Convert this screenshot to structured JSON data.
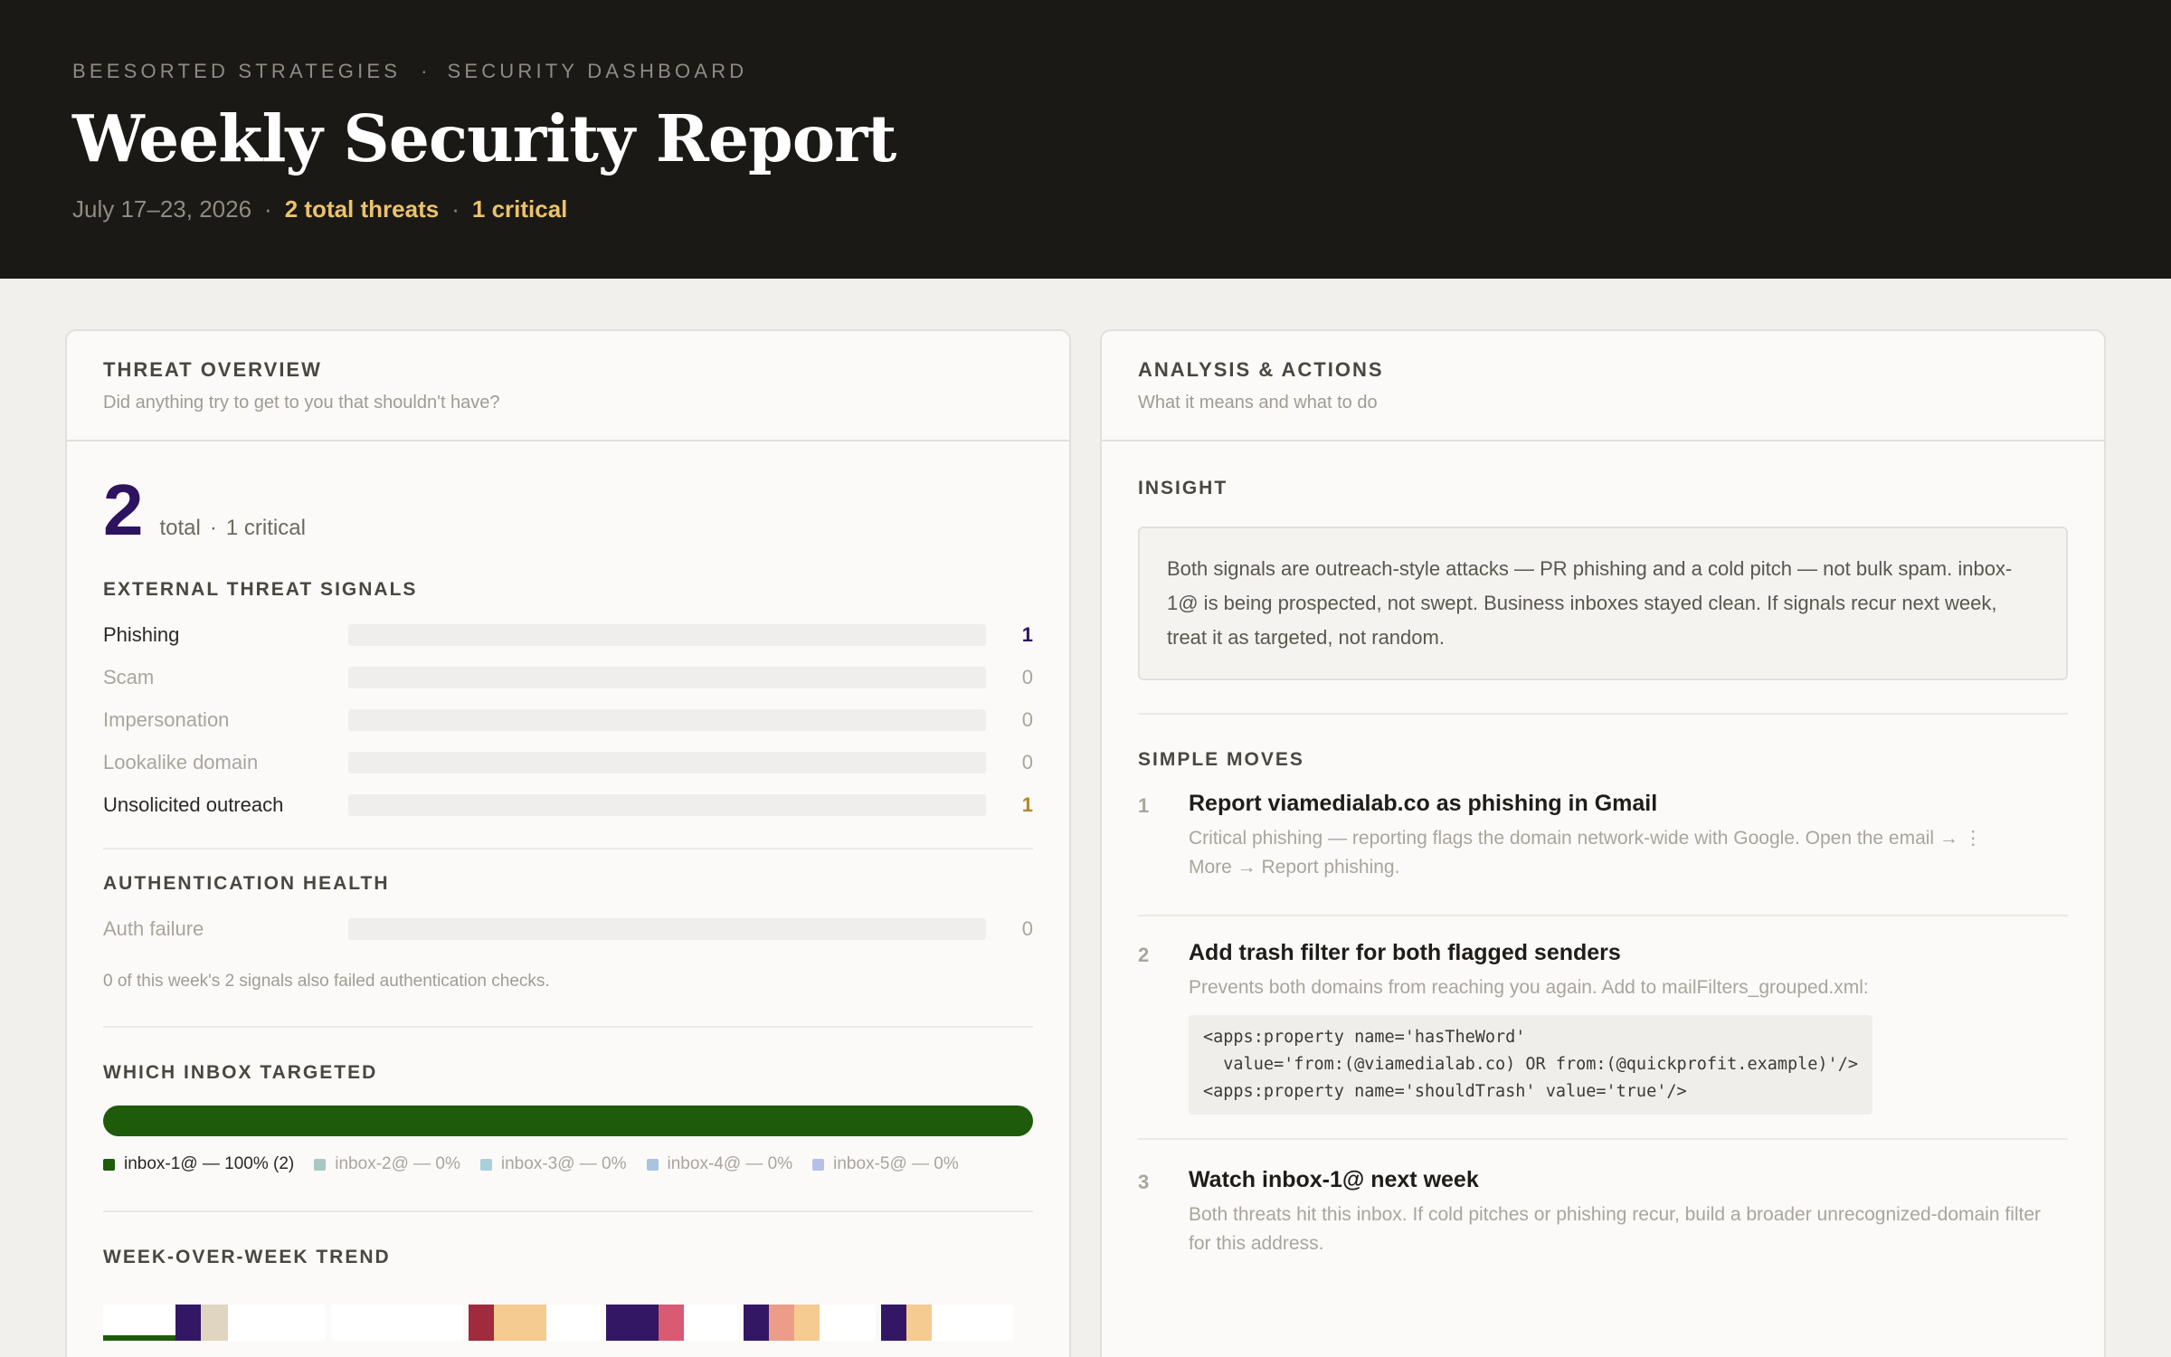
{
  "header": {
    "org": "BEESORTED STRATEGIES",
    "sep": "·",
    "section": "SECURITY DASHBOARD",
    "title": "Weekly Security Report",
    "date_range": "July 17–23, 2026",
    "total_threats": "2 total threats",
    "critical": "1 critical"
  },
  "threat_overview": {
    "title": "THREAT OVERVIEW",
    "subtitle": "Did anything try to get to you that shouldn't have?",
    "total": "2",
    "total_label": "total",
    "critical_label": "1 critical",
    "external_title": "EXTERNAL THREAT SIGNALS",
    "signals": [
      {
        "label": "Phishing",
        "value": "1",
        "fraction": 0.5,
        "color": "#331764"
      },
      {
        "label": "Scam",
        "value": "0",
        "fraction": 0,
        "color": "#cccccc"
      },
      {
        "label": "Impersonation",
        "value": "0",
        "fraction": 0,
        "color": "#cccccc"
      },
      {
        "label": "Lookalike domain",
        "value": "0",
        "fraction": 0,
        "color": "#cccccc"
      },
      {
        "label": "Unsolicited outreach",
        "value": "1",
        "fraction": 0.5,
        "color": "#f5cb91"
      }
    ],
    "auth_title": "AUTHENTICATION HEALTH",
    "auth": {
      "label": "Auth failure",
      "value": "0",
      "fraction": 0
    },
    "auth_note": "0 of this week's 2 signals also failed authentication checks.",
    "inbox_title": "WHICH INBOX TARGETED",
    "inbox_bar_color": "#1e5c0b",
    "inboxes": [
      {
        "label": "inbox-1@ — 100% (2)",
        "color": "#1e5c0b",
        "share": 1.0
      },
      {
        "label": "inbox-2@ — 0%",
        "color": "#a8c8c3",
        "share": 0
      },
      {
        "label": "inbox-3@ — 0%",
        "color": "#a9cfd8",
        "share": 0
      },
      {
        "label": "inbox-4@ — 0%",
        "color": "#a9c3e0",
        "share": 0
      },
      {
        "label": "inbox-5@ — 0%",
        "color": "#b6bfe6",
        "share": 0
      }
    ],
    "trend_title": "WEEK-OVER-WEEK TREND"
  },
  "analysis": {
    "title": "ANALYSIS & ACTIONS",
    "subtitle": "What it means and what to do",
    "insight_title": "INSIGHT",
    "insight": "Both signals are outreach-style attacks — PR phishing and a cold pitch — not bulk spam. inbox-1@ is being prospected, not swept. Business inboxes stayed clean. If signals recur next week, treat it as targeted, not random.",
    "moves_title": "SIMPLE MOVES",
    "moves": [
      {
        "num": "1",
        "title": "Report viamedialab.co as phishing in Gmail",
        "desc": "Critical phishing — reporting flags the domain network-wide with Google. Open the email → ⋮ More → Report phishing."
      },
      {
        "num": "2",
        "title": "Add trash filter for both flagged senders",
        "desc": "Prevents both domains from reaching you again. Add to mailFilters_grouped.xml:",
        "code": "<apps:property name='hasTheWord'\n  value='from:(@viamedialab.co) OR from:(@quickprofit.example)'/>\n<apps:property name='shouldTrash' value='true'/>"
      },
      {
        "num": "3",
        "title": "Watch inbox-1@ next week",
        "desc": "Both threats hit this inbox. If cold pitches or phishing recur, build a broader unrecognized-domain filter for this address."
      }
    ]
  },
  "colors": {
    "accent_purple": "#2d1461",
    "accent_gold": "#ecc26a",
    "header_bg": "#1b1916"
  }
}
